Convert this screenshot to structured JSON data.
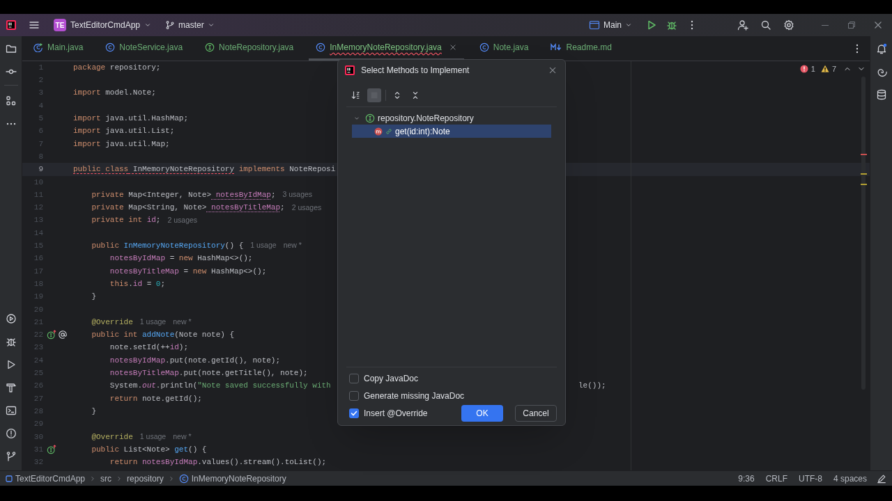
{
  "title_bar": {
    "project_badge": "TE",
    "project": "TextEditorCmdApp",
    "branch": "master",
    "run_config": "Main"
  },
  "tabs": [
    {
      "label": "Main.java",
      "kind": "main",
      "selected": false,
      "error": false
    },
    {
      "label": "NoteService.java",
      "kind": "class",
      "selected": false,
      "error": false
    },
    {
      "label": "NoteRepository.java",
      "kind": "interface",
      "selected": false,
      "error": false
    },
    {
      "label": "InMemoryNoteRepository.java",
      "kind": "class",
      "selected": true,
      "error": true
    },
    {
      "label": "Note.java",
      "kind": "class",
      "selected": false,
      "error": false
    },
    {
      "label": "Readme.md",
      "kind": "markdown",
      "selected": false,
      "error": false
    }
  ],
  "inspections": {
    "errors": "1",
    "warnings": "7"
  },
  "editor": {
    "lines": [
      {
        "n": "1",
        "current": false,
        "segs": [
          {
            "kind": "keyword",
            "t": "package"
          },
          {
            "kind": "plain",
            "t": " repository;"
          }
        ]
      },
      {
        "n": "2",
        "current": false
      },
      {
        "n": "3",
        "current": false,
        "segs": [
          {
            "kind": "keyword",
            "t": "import"
          },
          {
            "kind": "plain",
            "t": " model.Note;"
          }
        ]
      },
      {
        "n": "4",
        "current": false
      },
      {
        "n": "5",
        "current": false,
        "segs": [
          {
            "kind": "keyword",
            "t": "import"
          },
          {
            "kind": "plain",
            "t": " java.util.HashMap;"
          }
        ]
      },
      {
        "n": "6",
        "current": false,
        "segs": [
          {
            "kind": "keyword",
            "t": "import"
          },
          {
            "kind": "plain",
            "t": " java.util.List;"
          }
        ]
      },
      {
        "n": "7",
        "current": false,
        "segs": [
          {
            "kind": "keyword",
            "t": "import"
          },
          {
            "kind": "plain",
            "t": " java.util.Map;"
          }
        ]
      },
      {
        "n": "8",
        "current": false
      },
      {
        "n": "9",
        "current": true,
        "segs": [
          {
            "kind": "keyword",
            "t": "public class",
            "error": true
          },
          {
            "kind": "plain",
            "t": " InMemoryNoteRepository",
            "error": true
          },
          {
            "kind": "keyword",
            "t": " implements",
            "error": false
          },
          {
            "kind": "plain",
            "t": " NoteReposi",
            "error": false
          }
        ]
      },
      {
        "n": "10",
        "current": false
      },
      {
        "n": "11",
        "current": false,
        "segs": [
          {
            "kind": "keyword",
            "t": "    private"
          },
          {
            "kind": "plain",
            "t": " Map<Integer, Note>"
          },
          {
            "kind": "field",
            "t": " notesByIdMap",
            "underlined": true
          },
          {
            "kind": "plain",
            "t": ";"
          }
        ],
        "hints": [
          "3 usages"
        ]
      },
      {
        "n": "12",
        "current": false,
        "segs": [
          {
            "kind": "keyword",
            "t": "    private"
          },
          {
            "kind": "plain",
            "t": " Map<String, Note>"
          },
          {
            "kind": "field",
            "t": " notesByTitleMap",
            "underlined": true
          },
          {
            "kind": "plain",
            "t": ";"
          }
        ],
        "hints": [
          "2 usages"
        ]
      },
      {
        "n": "13",
        "current": false,
        "segs": [
          {
            "kind": "keyword",
            "t": "    private int"
          },
          {
            "kind": "field",
            "t": " id"
          },
          {
            "kind": "plain",
            "t": ";"
          }
        ],
        "hints": [
          "2 usages"
        ]
      },
      {
        "n": "14",
        "current": false
      },
      {
        "n": "15",
        "current": false,
        "segs": [
          {
            "kind": "keyword",
            "t": "    public"
          },
          {
            "kind": "method",
            "t": " InMemoryNoteRepository"
          },
          {
            "kind": "plain",
            "t": "() {"
          }
        ],
        "hints": [
          "1 usage",
          "new *"
        ]
      },
      {
        "n": "16",
        "current": false,
        "segs": [
          {
            "kind": "field",
            "t": "        notesByIdMap"
          },
          {
            "kind": "plain",
            "t": " ="
          },
          {
            "kind": "keyword",
            "t": " new"
          },
          {
            "kind": "plain",
            "t": " HashMap<>();"
          }
        ]
      },
      {
        "n": "17",
        "current": false,
        "segs": [
          {
            "kind": "field",
            "t": "        notesByTitleMap"
          },
          {
            "kind": "plain",
            "t": " ="
          },
          {
            "kind": "keyword",
            "t": " new"
          },
          {
            "kind": "plain",
            "t": " HashMap<>();"
          }
        ]
      },
      {
        "n": "18",
        "current": false,
        "segs": [
          {
            "kind": "keyword",
            "t": "        this"
          },
          {
            "kind": "plain",
            "t": "."
          },
          {
            "kind": "field",
            "t": "id"
          },
          {
            "kind": "plain",
            "t": " ="
          },
          {
            "kind": "number",
            "t": " 0"
          },
          {
            "kind": "plain",
            "t": ";"
          }
        ]
      },
      {
        "n": "19",
        "current": false,
        "segs": [
          {
            "kind": "plain",
            "t": "    }"
          }
        ]
      },
      {
        "n": "20",
        "current": false
      },
      {
        "n": "21",
        "current": false,
        "segs": [
          {
            "kind": "annotation",
            "t": "    @Override"
          }
        ],
        "hints": [
          "1 usage",
          "new *"
        ]
      },
      {
        "n": "22",
        "current": false,
        "gutter": [
          {
            "kind": "implements"
          },
          {
            "kind": "annotation"
          }
        ],
        "segs": [
          {
            "kind": "keyword",
            "t": "    public int"
          },
          {
            "kind": "method",
            "t": " addNote"
          },
          {
            "kind": "plain",
            "t": "(Note note) {"
          }
        ]
      },
      {
        "n": "23",
        "current": false,
        "segs": [
          {
            "kind": "plain",
            "t": "        note.setId(++"
          },
          {
            "kind": "field",
            "t": "id"
          },
          {
            "kind": "plain",
            "t": ");"
          }
        ]
      },
      {
        "n": "24",
        "current": false,
        "segs": [
          {
            "kind": "field",
            "t": "        notesByIdMap"
          },
          {
            "kind": "plain",
            "t": ".put(note.getId(), note);"
          }
        ]
      },
      {
        "n": "25",
        "current": false,
        "segs": [
          {
            "kind": "field",
            "t": "        notesByTitleMap"
          },
          {
            "kind": "plain",
            "t": ".put(note.getTitle(), note);"
          }
        ]
      },
      {
        "n": "26",
        "current": false,
        "segs": [
          {
            "kind": "plain",
            "t": "        System."
          },
          {
            "kind": "static",
            "t": "out"
          },
          {
            "kind": "plain",
            "t": ".println("
          },
          {
            "kind": "string",
            "t": "\"Note saved successfully with"
          }
        ],
        "tail": "le());"
      },
      {
        "n": "27",
        "current": false,
        "segs": [
          {
            "kind": "keyword",
            "t": "        return"
          },
          {
            "kind": "plain",
            "t": " note.getId();"
          }
        ]
      },
      {
        "n": "28",
        "current": false,
        "segs": [
          {
            "kind": "plain",
            "t": "    }"
          }
        ]
      },
      {
        "n": "29",
        "current": false
      },
      {
        "n": "30",
        "current": false,
        "segs": [
          {
            "kind": "annotation",
            "t": "    @Override"
          }
        ],
        "hints": [
          "1 usage",
          "new *"
        ]
      },
      {
        "n": "31",
        "current": false,
        "gutter": [
          {
            "kind": "implements"
          }
        ],
        "segs": [
          {
            "kind": "keyword",
            "t": "    public"
          },
          {
            "kind": "plain",
            "t": " List<Note>"
          },
          {
            "kind": "method",
            "t": " get"
          },
          {
            "kind": "plain",
            "t": "() {"
          }
        ]
      },
      {
        "n": "32",
        "current": false,
        "segs": [
          {
            "kind": "keyword",
            "t": "        return"
          },
          {
            "kind": "field",
            "t": " notesByIdMap"
          },
          {
            "kind": "plain",
            "t": ".values().stream().toList();"
          }
        ]
      }
    ]
  },
  "dialog": {
    "title": "Select Methods to Implement",
    "toolbar": [
      {
        "kind": "sort",
        "on": false
      },
      {
        "kind": "toggle",
        "on": true
      },
      {
        "kind": "expand",
        "on": false
      },
      {
        "kind": "collapse",
        "on": false
      }
    ],
    "tree": [
      {
        "label": "repository.NoteRepository",
        "expanded": true,
        "selected": false,
        "children": [
          {
            "label": "get(id:int):Note",
            "selected": true
          }
        ]
      }
    ],
    "options": [
      {
        "label": "Copy JavaDoc",
        "checked": false
      },
      {
        "label": "Generate missing JavaDoc",
        "checked": false
      },
      {
        "label": "Insert @Override",
        "checked": true
      }
    ],
    "ok": "OK",
    "cancel": "Cancel"
  },
  "status_bar": {
    "breadcrumbs": [
      {
        "label": "TextEditorCmdApp",
        "kind": "module"
      },
      {
        "label": "src",
        "kind": "folder"
      },
      {
        "label": "repository",
        "kind": "folder"
      },
      {
        "label": "InMemoryNoteRepository",
        "kind": "class"
      }
    ],
    "items": [
      "9:36",
      "CRLF",
      "UTF-8",
      "4 spaces"
    ]
  }
}
